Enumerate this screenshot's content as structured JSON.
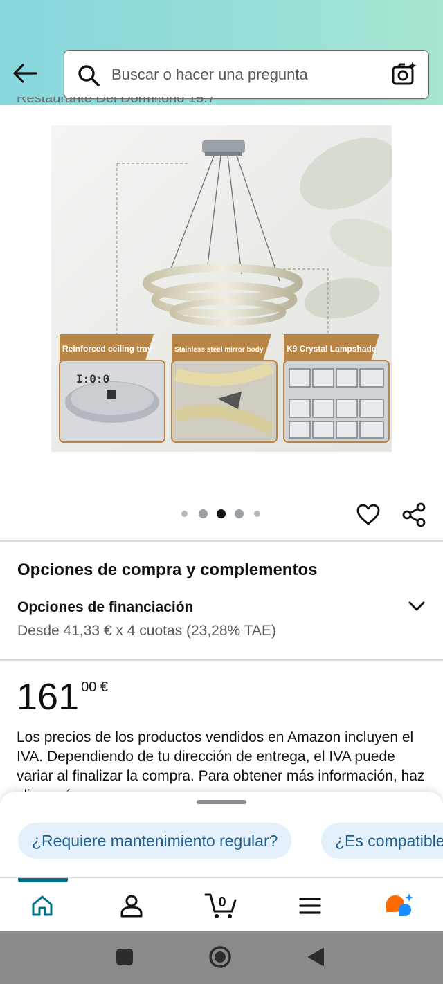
{
  "header": {
    "search_placeholder": "Buscar o hacer una pregunta"
  },
  "cut_title": "Restaurante Del Dormitorio 15.7",
  "product_image": {
    "labels": [
      "Reinforced ceiling tray",
      "Stainless steel mirror body",
      "K9 Crystal Lampshade"
    ],
    "dots_total": 5,
    "dots_active_index": 2
  },
  "buying": {
    "title": "Opciones de compra y complementos",
    "financing_title": "Opciones de financiación",
    "financing_sub": "Desde 41,33 € x 4 cuotas (23,28% TAE)"
  },
  "price": {
    "whole": "161",
    "fraction": "00 €"
  },
  "tax_text": "Los precios de los productos vendidos en Amazon incluyen el IVA. Dependiendo de tu dirección de entrega, el IVA puede variar al finalizar la compra. Para obtener más información, haz clic aquí.",
  "chips": [
    "¿Requiere mantenimiento regular?",
    "¿Es compatible con regulador?"
  ],
  "nav": {
    "cart_count": "0",
    "active": "home"
  },
  "colors": {
    "header_gradient_start": "#86d6dc",
    "header_gradient_end": "#a6e5d0",
    "accent_teal": "#007185",
    "chip_bg": "#e4f1fc",
    "chip_text": "#1f5f8b",
    "assistant_orange": "#ff6a00",
    "assistant_blue": "#1a8cff"
  }
}
